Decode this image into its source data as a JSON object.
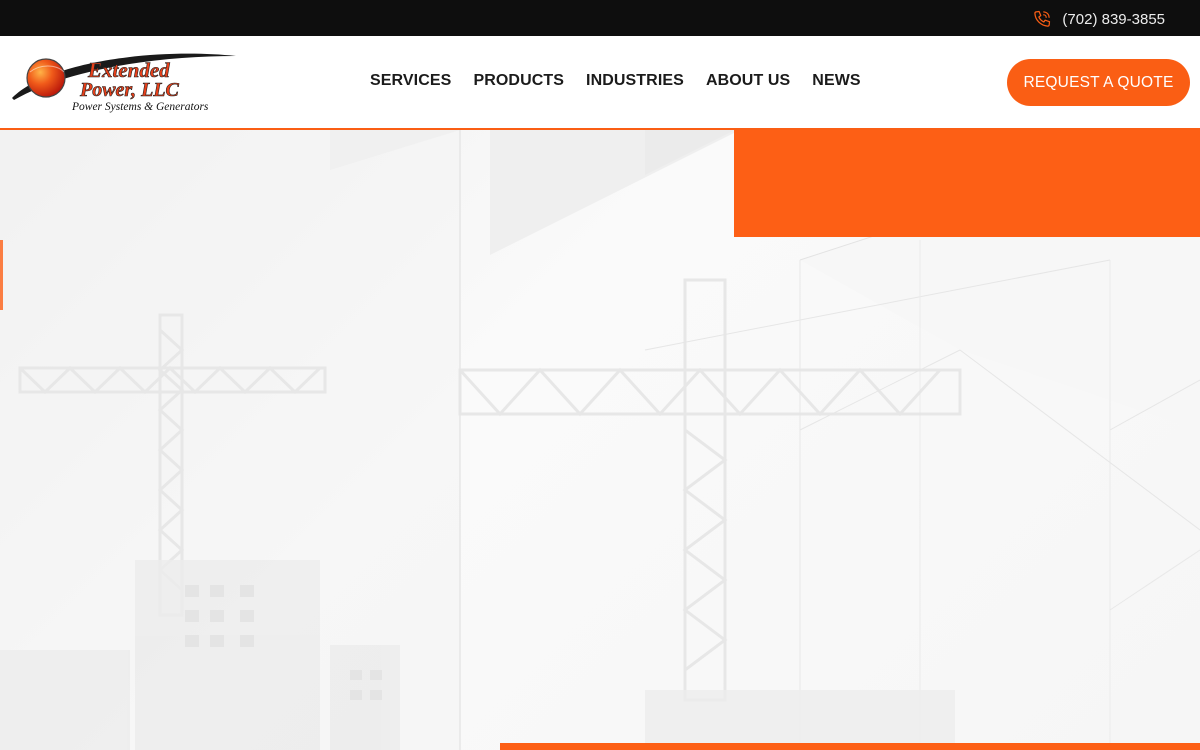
{
  "topbar": {
    "phone": "(702) 839-3855",
    "phone_icon": "phone-icon"
  },
  "header": {
    "logo": {
      "line1": "Extended",
      "line2": "Power, LLC",
      "tagline": "Power Systems & Generators"
    },
    "nav": [
      {
        "label": "SERVICES"
      },
      {
        "label": "PRODUCTS"
      },
      {
        "label": "INDUSTRIES"
      },
      {
        "label": "ABOUT US"
      },
      {
        "label": "NEWS"
      }
    ],
    "cta_label": "REQUEST A QUOTE"
  },
  "colors": {
    "accent": "#fa5e14",
    "topbar_bg": "#0e0e0e",
    "nav_text": "#1b1b1b"
  }
}
